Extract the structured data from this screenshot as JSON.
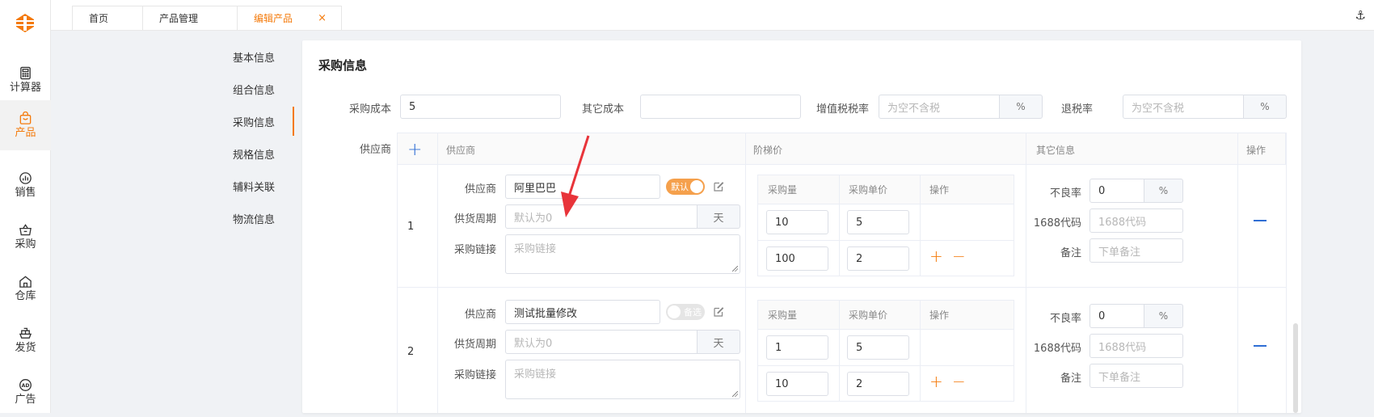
{
  "sidebar": {
    "items": [
      {
        "label": "计算器",
        "icon": "calculator-icon"
      },
      {
        "label": "产品",
        "icon": "bag-icon",
        "active": true
      },
      {
        "label": "销售",
        "icon": "sales-chart-icon"
      },
      {
        "label": "采购",
        "icon": "basket-icon"
      },
      {
        "label": "仓库",
        "icon": "warehouse-icon"
      },
      {
        "label": "发货",
        "icon": "ship-icon"
      },
      {
        "label": "广告",
        "icon": "ad-icon"
      }
    ]
  },
  "tabs": [
    {
      "label": "首页"
    },
    {
      "label": "产品管理"
    },
    {
      "label": "编辑产品",
      "active": true,
      "close": "×"
    }
  ],
  "header_icon": "⚓",
  "anchors": [
    "基本信息",
    "组合信息",
    "采购信息",
    "规格信息",
    "辅料关联",
    "物流信息"
  ],
  "section": {
    "title": "采购信息",
    "cost": {
      "label": "采购成本",
      "value": "5"
    },
    "other_cost": {
      "label": "其它成本",
      "value": ""
    },
    "vat": {
      "label": "增值税税率",
      "placeholder": "为空不含税",
      "suffix": "%"
    },
    "refund": {
      "label": "退税率",
      "placeholder": "为空不含税",
      "suffix": "%"
    },
    "supplier_label": "供应商"
  },
  "table": {
    "headers": {
      "supplier": "供应商",
      "tier": "阶梯价",
      "other": "其它信息",
      "action": "操作"
    },
    "sub_headers": {
      "qty": "采购量",
      "price": "采购单价",
      "action": "操作"
    },
    "field_labels": {
      "supplier": "供应商",
      "period": "供货周期",
      "link": "采购链接",
      "defect": "不良率",
      "code": "1688代码",
      "note": "备注"
    },
    "placeholders": {
      "period": "默认为0",
      "period_suffix": "天",
      "link": "采购链接",
      "code": "1688代码",
      "note": "下单备注",
      "defect_suffix": "%"
    },
    "rows": [
      {
        "index": "1",
        "supplier": "阿里巴巴",
        "switch": "默认",
        "switch_on": true,
        "tiers": [
          {
            "qty": "10",
            "price": "5"
          },
          {
            "qty": "100",
            "price": "2"
          }
        ],
        "defect": "0"
      },
      {
        "index": "2",
        "supplier": "测试批量修改",
        "switch": "备选",
        "switch_on": false,
        "tiers": [
          {
            "qty": "1",
            "price": "5"
          },
          {
            "qty": "10",
            "price": "2"
          }
        ],
        "defect": "0"
      }
    ]
  },
  "colors": {
    "accent": "#f47a0b",
    "blue": "#2f6ed4",
    "annotation_arrow": "#e8343a"
  }
}
